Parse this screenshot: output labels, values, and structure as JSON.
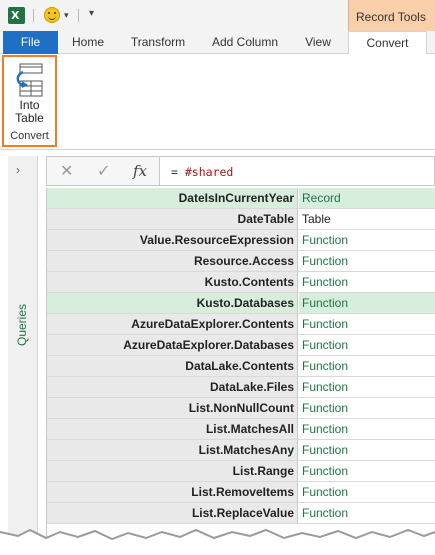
{
  "qat": {
    "app_icon_letter": "X",
    "customize_glyph": "▾"
  },
  "context_group": {
    "label": "Record Tools"
  },
  "tabs": [
    {
      "label": "File"
    },
    {
      "label": "Home"
    },
    {
      "label": "Transform"
    },
    {
      "label": "Add Column"
    },
    {
      "label": "View"
    },
    {
      "label": "Convert"
    }
  ],
  "ribbon": {
    "button_label_line1": "Into",
    "button_label_line2": "Table",
    "group_label": "Convert"
  },
  "queries_pane": {
    "label": "Queries",
    "chevron": "›"
  },
  "formula_bar": {
    "cancel_glyph": "✕",
    "confirm_glyph": "✓",
    "fx_label": "fx",
    "equals": "=",
    "expression": "#shared"
  },
  "grid": {
    "rows": [
      {
        "name": "DateIsInCurrentYear",
        "value": "Record",
        "selected": true
      },
      {
        "name": "DateTable",
        "value": "Table"
      },
      {
        "name": "Value.ResourceExpression",
        "value": "Function"
      },
      {
        "name": "Resource.Access",
        "value": "Function"
      },
      {
        "name": "Kusto.Contents",
        "value": "Function"
      },
      {
        "name": "Kusto.Databases",
        "value": "Function",
        "selected": true
      },
      {
        "name": "AzureDataExplorer.Contents",
        "value": "Function"
      },
      {
        "name": "AzureDataExplorer.Databases",
        "value": "Function"
      },
      {
        "name": "DataLake.Contents",
        "value": "Function"
      },
      {
        "name": "DataLake.Files",
        "value": "Function"
      },
      {
        "name": "List.NonNullCount",
        "value": "Function"
      },
      {
        "name": "List.MatchesAll",
        "value": "Function"
      },
      {
        "name": "List.MatchesAny",
        "value": "Function"
      },
      {
        "name": "List.Range",
        "value": "Function"
      },
      {
        "name": "List.RemoveItems",
        "value": "Function"
      },
      {
        "name": "List.ReplaceValue",
        "value": "Function"
      }
    ]
  },
  "colors": {
    "file_tab": "#1f6fc5",
    "context_tab": "#f8cfa9",
    "highlight_border": "#f47b20",
    "value_text": "#217346",
    "selected_row": "#d7eedd"
  }
}
